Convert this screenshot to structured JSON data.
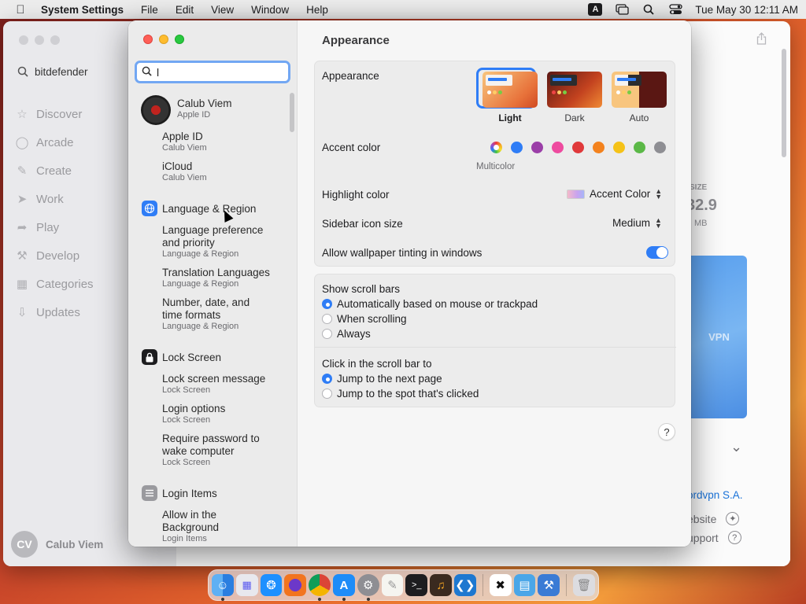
{
  "menubar": {
    "app_name": "System Settings",
    "menus": [
      "File",
      "Edit",
      "View",
      "Window",
      "Help"
    ],
    "input_badge": "A",
    "clock": "Tue May 30  12:11 AM"
  },
  "background_app": {
    "search_text": "bitdefender",
    "nav": [
      "Discover",
      "Arcade",
      "Create",
      "Work",
      "Play",
      "Develop",
      "Categories",
      "Updates"
    ],
    "user_initials": "CV",
    "user_name": "Calub Viem",
    "size_label": "SIZE",
    "size_value": "32.9",
    "size_unit": "MB",
    "promo_text": "VPN",
    "developer": "ordvpn S.A.",
    "link_website": "ebsite",
    "link_support": "upport"
  },
  "settings": {
    "search": {
      "value": "l",
      "placeholder": "Search"
    },
    "user": {
      "name": "Calub Viem",
      "subtitle": "Apple ID"
    },
    "results": [
      {
        "title": "Apple ID",
        "sub": "Calub Viem"
      },
      {
        "title": "iCloud",
        "sub": "Calub Viem"
      },
      {
        "title": "Language & Region"
      },
      {
        "title": "Language preference and priority",
        "sub": "Language & Region"
      },
      {
        "title": "Translation Languages",
        "sub": "Language & Region"
      },
      {
        "title": "Number, date, and time formats",
        "sub": "Language & Region"
      },
      {
        "title": "Lock Screen"
      },
      {
        "title": "Lock screen message",
        "sub": "Lock Screen"
      },
      {
        "title": "Login options",
        "sub": "Lock Screen"
      },
      {
        "title": "Require password to wake computer",
        "sub": "Lock Screen"
      },
      {
        "title": "Login Items"
      },
      {
        "title": "Allow in the Background",
        "sub": "Login Items"
      }
    ],
    "page_title": "Appearance",
    "appearance_label": "Appearance",
    "appearance_options": [
      "Light",
      "Dark",
      "Auto"
    ],
    "appearance_selected": "Light",
    "accent_label": "Accent color",
    "accent_colors": [
      "#2f7df6",
      "#9b3fa8",
      "#ee4b9f",
      "#e0393b",
      "#f3821e",
      "#f5c218",
      "#5bb847",
      "#8e8e93"
    ],
    "accent_selected_label": "Multicolor",
    "highlight_label": "Highlight color",
    "highlight_value": "Accent Color",
    "sidebar_icon_label": "Sidebar icon size",
    "sidebar_icon_value": "Medium",
    "wallpaper_tint_label": "Allow wallpaper tinting in windows",
    "wallpaper_tint_on": true,
    "scrollbars_label": "Show scroll bars",
    "scrollbar_options": [
      "Automatically based on mouse or trackpad",
      "When scrolling",
      "Always"
    ],
    "click_label": "Click in the scroll bar to",
    "click_options": [
      "Jump to the next page",
      "Jump to the spot that's clicked"
    ],
    "help": "?"
  },
  "colors": {
    "accent": "#2f7df6"
  }
}
